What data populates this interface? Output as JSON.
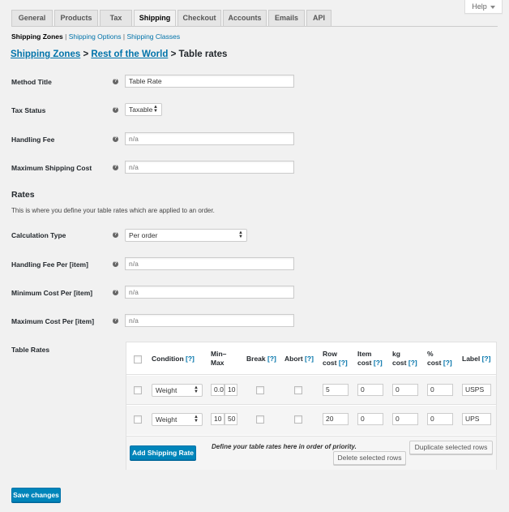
{
  "help": {
    "label": "Help"
  },
  "tabs": [
    {
      "label": "General"
    },
    {
      "label": "Products"
    },
    {
      "label": "Tax"
    },
    {
      "label": "Shipping"
    },
    {
      "label": "Checkout"
    },
    {
      "label": "Accounts"
    },
    {
      "label": "Emails"
    },
    {
      "label": "API"
    }
  ],
  "subnav": {
    "current": "Shipping Zones",
    "options": "Shipping Options",
    "classes": "Shipping Classes",
    "sep": "|"
  },
  "breadcrumb": {
    "zones": "Shipping Zones",
    "zone": "Rest of the World",
    "sep": ">",
    "page": "Table rates"
  },
  "fields": {
    "method_title": {
      "label": "Method Title",
      "value": "Table Rate"
    },
    "tax_status": {
      "label": "Tax Status",
      "value": "Taxable"
    },
    "handling_fee": {
      "label": "Handling Fee",
      "placeholder": "n/a"
    },
    "max_shipping_cost": {
      "label": "Maximum Shipping Cost",
      "placeholder": "n/a"
    }
  },
  "rates": {
    "heading": "Rates",
    "description": "This is where you define your table rates which are applied to an order.",
    "calculation_type": {
      "label": "Calculation Type",
      "value": "Per order"
    },
    "handling_fee_per": {
      "label": "Handling Fee Per [item]",
      "placeholder": "n/a"
    },
    "min_cost_per": {
      "label": "Minimum Cost Per [item]",
      "placeholder": "n/a"
    },
    "max_cost_per": {
      "label": "Maximum Cost Per [item]",
      "placeholder": "n/a"
    }
  },
  "table_rates": {
    "label": "Table Rates",
    "help": "[?]",
    "columns": {
      "condition": "Condition",
      "minmax_1": "Min–",
      "minmax_2": "Max",
      "break": "Break",
      "abort": "Abort",
      "row_cost_1": "Row",
      "row_cost_2": "cost",
      "item_cost_1": "Item",
      "item_cost_2": "cost",
      "kg_cost_1": "kg",
      "kg_cost_2": "cost",
      "pct_cost_1": "%",
      "pct_cost_2": "cost",
      "label": "Label"
    },
    "rows": [
      {
        "condition": "Weight",
        "min": "0.0",
        "max": "10",
        "row_cost": "5",
        "item_cost": "0",
        "kg_cost": "0",
        "pct_cost": "0",
        "label": "USPS"
      },
      {
        "condition": "Weight",
        "min": "10",
        "max": "50",
        "row_cost": "20",
        "item_cost": "0",
        "kg_cost": "0",
        "pct_cost": "0",
        "label": "UPS"
      }
    ],
    "add_button": "Add Shipping Rate",
    "note": "Define your table rates here in order of priority.",
    "duplicate_button": "Duplicate selected rows",
    "delete_button": "Delete selected rows"
  },
  "save_button": "Save changes",
  "colors": {
    "primary": "#0085ba",
    "link": "#0073aa",
    "background": "#f1f1f1"
  }
}
